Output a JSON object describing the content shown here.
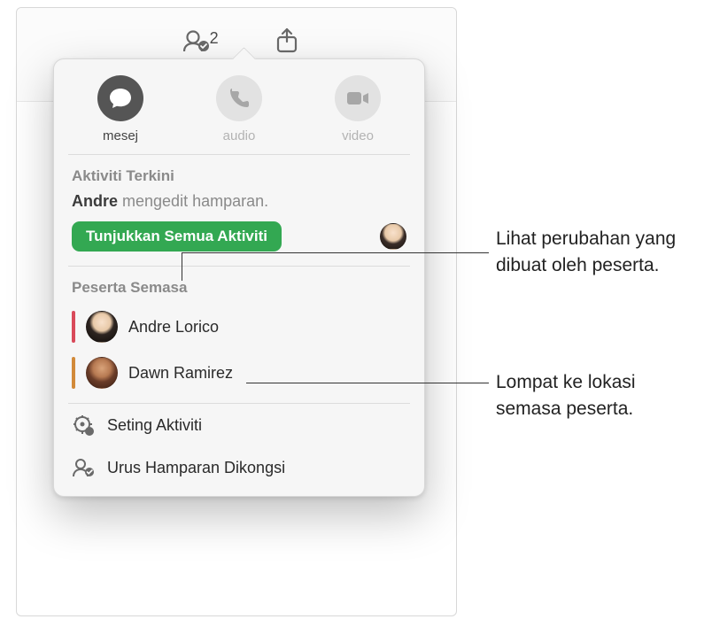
{
  "toolbar": {
    "collaborate": {
      "label": "Kerjasama",
      "badge": "2"
    },
    "share": {
      "label": "Kongsi"
    }
  },
  "communication": {
    "message": {
      "label": "mesej"
    },
    "audio": {
      "label": "audio"
    },
    "video": {
      "label": "video"
    }
  },
  "activity": {
    "section_title": "Aktiviti Terkini",
    "actor": "Andre",
    "action_text": " mengedit hamparan.",
    "show_all_label": "Tunjukkan Semua Aktiviti"
  },
  "participants": {
    "section_title": "Peserta Semasa",
    "list": [
      {
        "name": "Andre Lorico",
        "bar_color": "#d94a5a"
      },
      {
        "name": "Dawn Ramirez",
        "bar_color": "#d28a3a"
      }
    ]
  },
  "options": {
    "activity_settings": "Seting Aktiviti",
    "manage_shared": "Urus Hamparan Dikongsi"
  },
  "callouts": {
    "changes": "Lihat perubahan yang dibuat oleh peserta.",
    "jump": "Lompat ke lokasi semasa peserta."
  }
}
